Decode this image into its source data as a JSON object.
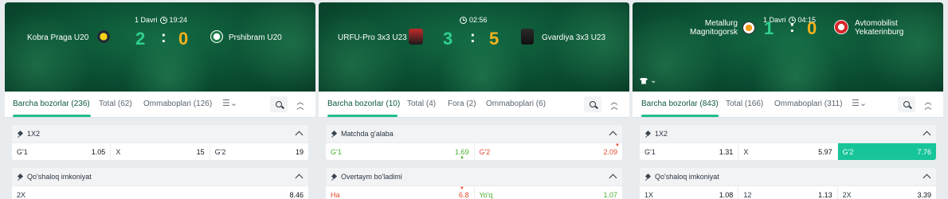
{
  "matches": [
    {
      "status": "1 Davri",
      "time": "19:24",
      "home": "Kobra Praga U20",
      "away": "Prshibram U20",
      "home_score": "2",
      "away_score": "0",
      "tabs": [
        {
          "label": "Barcha bozorlar (236)",
          "active": true
        },
        {
          "label": "Total (62)",
          "active": false
        },
        {
          "label": "Ommaboplari (126)",
          "active": false
        }
      ],
      "markets": [
        {
          "title": "1X2",
          "odds": [
            {
              "label": "G'1",
              "value": "1.05",
              "state": "normal"
            },
            {
              "label": "X",
              "value": "15",
              "state": "normal"
            },
            {
              "label": "G'2",
              "value": "19",
              "state": "normal"
            }
          ]
        },
        {
          "title": "Qo'shaloq imkoniyat",
          "odds": [
            {
              "label": "2X",
              "value": "8.46",
              "state": "normal"
            }
          ]
        }
      ]
    },
    {
      "status": "",
      "time": "02:56",
      "home": "URFU-Pro 3x3 U23",
      "away": "Gvardiya 3x3 U23",
      "home_score": "3",
      "away_score": "5",
      "tabs": [
        {
          "label": "Barcha bozorlar (10)",
          "active": true
        },
        {
          "label": "Total (4)",
          "active": false
        },
        {
          "label": "Fora (2)",
          "active": false
        },
        {
          "label": "Ommaboplari (6)",
          "active": false
        }
      ],
      "markets": [
        {
          "title": "Matchda g'alaba",
          "odds": [
            {
              "label": "G'1",
              "value": "1.69",
              "state": "up"
            },
            {
              "label": "G'2",
              "value": "2.09",
              "state": "down"
            }
          ]
        },
        {
          "title": "Overtaym bo'ladimi",
          "odds": [
            {
              "label": "Ha",
              "value": "6.8",
              "state": "down"
            },
            {
              "label": "Yo'q",
              "value": "1.07",
              "state": "up"
            }
          ]
        }
      ]
    },
    {
      "status": "1 Davri",
      "time": "04:15",
      "home": "Metallurg Magnitogorsk",
      "home_line1": "Metallurg",
      "home_line2": "Magnitogorsk",
      "away": "Avtomobilist Yekaterinburg",
      "away_line1": "Avtomobilist",
      "away_line2": "Yekaterinburg",
      "home_score": "1",
      "away_score": "0",
      "tabs": [
        {
          "label": "Barcha bozorlar (843)",
          "active": true
        },
        {
          "label": "Total (166)",
          "active": false
        },
        {
          "label": "Ommaboplari (311)",
          "active": false
        }
      ],
      "markets": [
        {
          "title": "1X2",
          "odds": [
            {
              "label": "G'1",
              "value": "1.31",
              "state": "normal"
            },
            {
              "label": "X",
              "value": "5.97",
              "state": "normal"
            },
            {
              "label": "G'2",
              "value": "7.76",
              "state": "selected"
            }
          ]
        },
        {
          "title": "Qo'shaloq imkoniyat",
          "odds": [
            {
              "label": "1X",
              "value": "1.08",
              "state": "normal"
            },
            {
              "label": "12",
              "value": "1.13",
              "state": "normal"
            },
            {
              "label": "2X",
              "value": "3.39",
              "state": "normal"
            }
          ]
        }
      ]
    }
  ],
  "colors": {
    "accent": "#18c59a",
    "score_win": "#2fd08d",
    "score_lose": "#f6b21b",
    "odds_up": "#4caf2e",
    "odds_down": "#e5482d"
  },
  "icons": {
    "clock": "clock-icon",
    "pin": "pin-icon",
    "search": "search-icon",
    "collapse": "chevrons-up-icon",
    "filter": "list-filter-icon",
    "shirt": "shirt-icon"
  }
}
